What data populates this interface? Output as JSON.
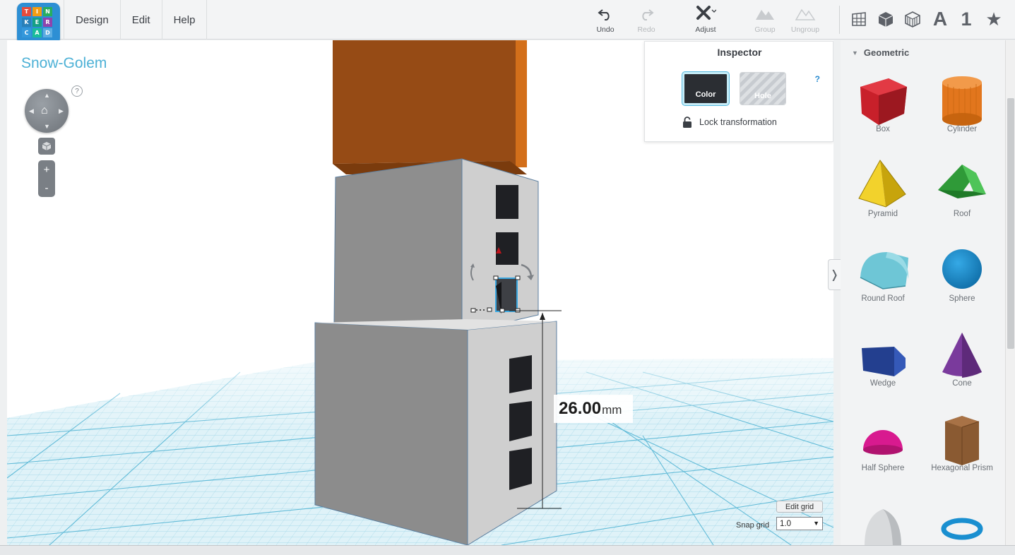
{
  "logo": {
    "letters": [
      "T",
      "I",
      "N",
      "K",
      "E",
      "R",
      "C",
      "A",
      "D"
    ]
  },
  "menu": [
    "Design",
    "Edit",
    "Help"
  ],
  "toolbar": {
    "undo": "Undo",
    "redo": "Redo",
    "adjust": "Adjust",
    "group": "Group",
    "ungroup": "Ungroup"
  },
  "view_icons": [
    "grid-view-icon",
    "box-view-icon",
    "striped-box-icon",
    "text-A-icon",
    "number-1-icon",
    "star-icon"
  ],
  "view_icon_text": {
    "text": "A",
    "number": "1",
    "star": "★"
  },
  "project": {
    "title": "Snow-Golem"
  },
  "nav": {
    "help": "?",
    "zoom_in": "+",
    "zoom_out": "-"
  },
  "dimension": {
    "value": "26.00",
    "unit": "mm"
  },
  "inspector": {
    "title": "Inspector",
    "help": "?",
    "color_label": "Color",
    "hole_label": "Hole",
    "lock_label": "Lock transformation"
  },
  "grid": {
    "edit_label": "Edit grid",
    "snap_label": "Snap grid",
    "snap_value": "1.0"
  },
  "panel_toggle": "❭",
  "library": {
    "category": "Geometric",
    "shapes": [
      {
        "name": "Box",
        "color": "#c8202a"
      },
      {
        "name": "Cylinder",
        "color": "#e2761d"
      },
      {
        "name": "Pyramid",
        "color": "#e9c516"
      },
      {
        "name": "Roof",
        "color": "#33a33d"
      },
      {
        "name": "Round Roof",
        "color": "#6ec6d6"
      },
      {
        "name": "Sphere",
        "color": "#1a8fd0"
      },
      {
        "name": "Wedge",
        "color": "#233f8f"
      },
      {
        "name": "Cone",
        "color": "#7a3a9c"
      },
      {
        "name": "Half Sphere",
        "color": "#d81a8f"
      },
      {
        "name": "Hexagonal Prism",
        "color": "#8a5a32"
      },
      {
        "name": "Paraboloid",
        "color": "#d8dadc"
      },
      {
        "name": "Torus",
        "color": "#1a8fd0"
      }
    ]
  }
}
